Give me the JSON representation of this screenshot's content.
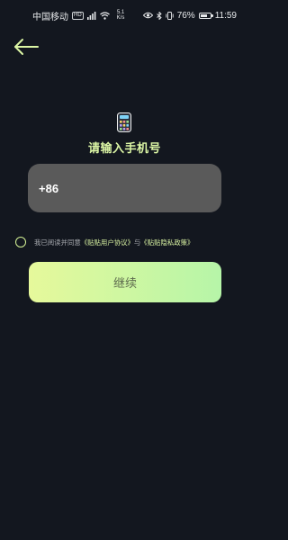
{
  "status_bar": {
    "carrier": "中国移动",
    "hd": "HD",
    "network_speed": "5.1",
    "network_speed_unit": "K/s",
    "battery_percent": "76%",
    "battery_level": 0.76,
    "time": "11:59"
  },
  "page": {
    "title": "请输入手机号"
  },
  "phone_input": {
    "country_code": "+86"
  },
  "agreement": {
    "prefix": "我已阅读并同意",
    "user_agreement": "《贴贴用户协议》",
    "conjunction": "与",
    "privacy_policy": "《贴贴隐私政策》"
  },
  "continue_button": {
    "label": "继续"
  },
  "colors": {
    "background": "#13171f",
    "accent": "#dcf6a5",
    "input_bg": "#5a5a5a",
    "button_gradient_start": "#e6f99b",
    "button_gradient_end": "#b6f5a8"
  },
  "icons": {
    "back": "arrow-left-icon",
    "phone": "calculator-phone-icon",
    "checkbox": "circle-checkbox-icon"
  }
}
